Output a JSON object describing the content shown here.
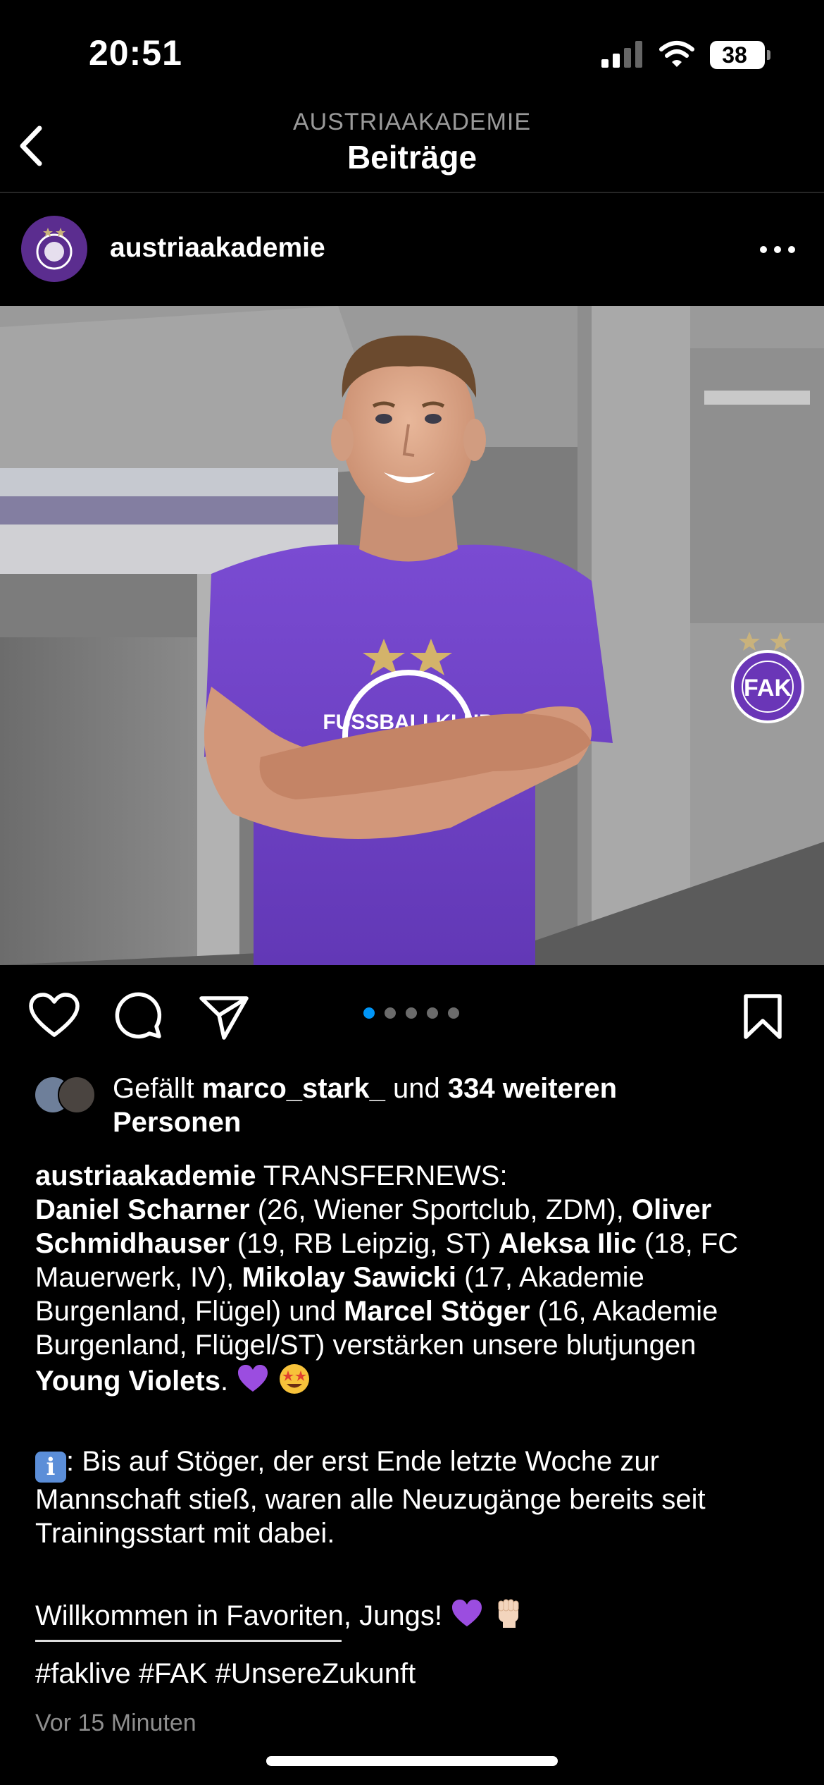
{
  "status_bar": {
    "time": "20:51",
    "battery": "38"
  },
  "header": {
    "account": "AUSTRIAAKADEMIE",
    "title": "Beiträge"
  },
  "post": {
    "username": "austriaakademie",
    "image": {
      "badge_text": "FUSSBALLKLUB AUSTRIA WIEN",
      "badge_monogram": "FAK",
      "shirt_text": "FUSSBALLKLUB"
    },
    "carousel": {
      "count": 5,
      "active_index": 0
    },
    "likes": {
      "prefix": "Gefällt ",
      "user": "marco_stark_",
      "mid": " und ",
      "count_text": "334 weiteren",
      "suffix": "Personen"
    },
    "caption": {
      "username": "austriaakademie",
      "line1_text": " TRANSFERNEWS:",
      "l2a": "Daniel Scharner",
      "l2b": " (26, Wiener Sportclub, ZDM), ",
      "l2c": "Oliver",
      "l3a": "Schmidhauser",
      "l3b": " (19, RB Leipzig, ST) ",
      "l3c": "Aleksa Ilic",
      "l3d": " (18, FC",
      "l4a": "Mauerwerk, IV), ",
      "l4b": "Mikolay Sawicki",
      "l4c": " (17, Akademie",
      "l5a": "Burgenland, Flügel) und ",
      "l5b": "Marcel Stöger",
      "l5c": " (16, Akademie",
      "l6": "Burgenland, Flügel/ST) verstärken unsere blutjungen",
      "l7a": "Young Violets",
      "l7b": ". ",
      "info1": ": Bis auf Stöger, der erst Ende letzte Woche zur",
      "info2": "Mannschaft stieß, waren alle Neuzugänge bereits seit",
      "info3": "Trainingsstart mit dabei.",
      "welcome": "Willkommen in Favoriten, Jungs! "
    },
    "hashtags": "#faklive #FAK #UnsereZukunft",
    "timestamp": "Vor 15 Minuten"
  },
  "icons": {
    "back": "chevron-left-icon",
    "more": "more-horizontal-icon",
    "like": "heart-icon",
    "comment": "comment-icon",
    "share": "send-icon",
    "save": "bookmark-icon",
    "emoji_heart": "purple-heart-icon",
    "emoji_starstruck": "star-struck-icon",
    "emoji_info": "information-icon",
    "emoji_fist": "raised-fist-icon"
  },
  "colors": {
    "accent_blue": "#0095f6",
    "club_violet": "#5b2d8f",
    "background": "#000000"
  }
}
